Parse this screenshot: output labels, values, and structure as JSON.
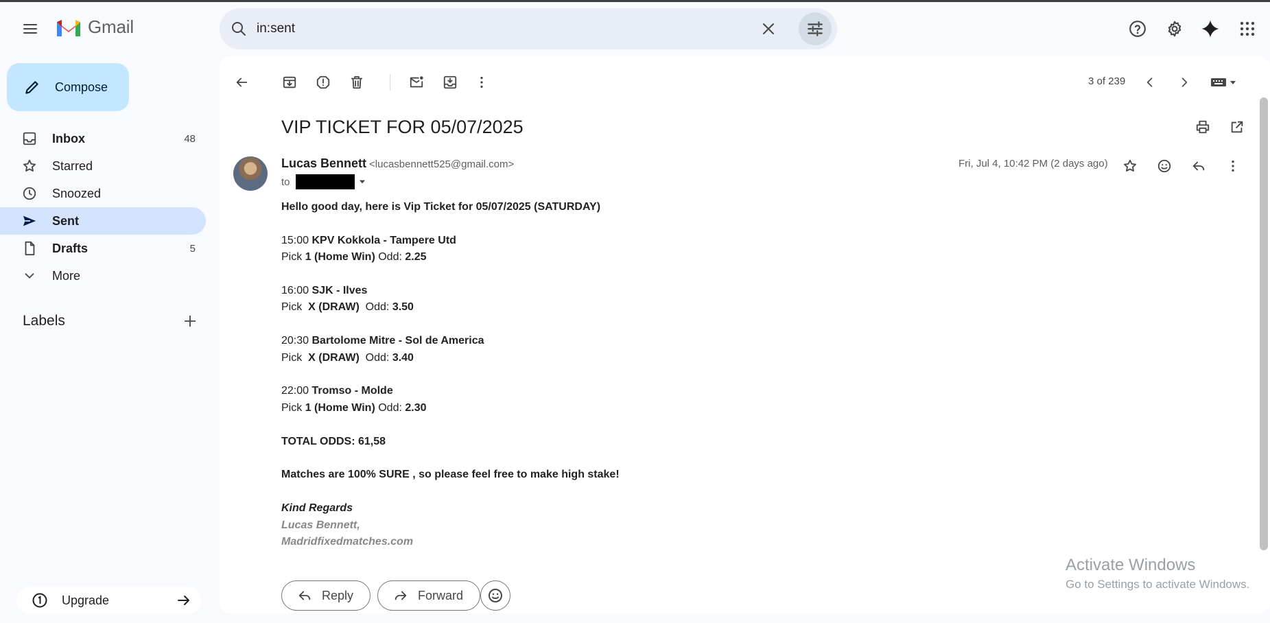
{
  "app": {
    "name": "Gmail"
  },
  "search": {
    "query": "in:sent"
  },
  "sidebar": {
    "compose_label": "Compose",
    "items": [
      {
        "label": "Inbox",
        "count": "48",
        "icon": "inbox-icon"
      },
      {
        "label": "Starred",
        "count": "",
        "icon": "star-icon"
      },
      {
        "label": "Snoozed",
        "count": "",
        "icon": "clock-icon"
      },
      {
        "label": "Sent",
        "count": "",
        "icon": "send-icon"
      },
      {
        "label": "Drafts",
        "count": "5",
        "icon": "draft-icon"
      },
      {
        "label": "More",
        "count": "",
        "icon": "chevron-down-icon"
      }
    ],
    "labels_title": "Labels",
    "upgrade_label": "Upgrade"
  },
  "toolbar": {
    "pager": "3 of 239"
  },
  "email": {
    "subject": "VIP TICKET FOR 05/07/2025",
    "sender_name": "Lucas Bennett",
    "sender_email": "<lucasbennett525@gmail.com>",
    "to_label": "to",
    "date": "Fri, Jul 4, 10:42 PM (2 days ago)",
    "greeting": "Hello good day, here is Vip Ticket for 05/07/2025 (SATURDAY)",
    "matches": [
      {
        "time": "15:00",
        "teams": "KPV Kokkola - Tampere Utd",
        "pick_label": "Pick",
        "pick": "1 (Home Win)",
        "odd_label": "Odd:",
        "odd": "2.25"
      },
      {
        "time": "16:00",
        "teams": "SJK - Ilves",
        "pick_label": "Pick",
        "pick": "X (DRAW)",
        "odd_label": "Odd:",
        "odd": "3.50"
      },
      {
        "time": "20:30",
        "teams": "Bartolome Mitre - Sol de America",
        "pick_label": "Pick",
        "pick": "X (DRAW)",
        "odd_label": "Odd:",
        "odd": "3.40"
      },
      {
        "time": "22:00",
        "teams": "Tromso - Molde",
        "pick_label": "Pick",
        "pick": "1 (Home Win)",
        "odd_label": "Odd:",
        "odd": "2.30"
      }
    ],
    "total": "TOTAL ODDS: 61,58",
    "note": "Matches are 100% SURE , so please feel free to make high stake!",
    "signoff": "Kind Regards",
    "sig_name": "Lucas Bennett,",
    "sig_site": "Madridfixedmatches.com"
  },
  "actions": {
    "reply": "Reply",
    "forward": "Forward"
  },
  "watermark": {
    "line1": "Activate Windows",
    "line2": "Go to Settings to activate Windows."
  },
  "colors": {
    "accent": "#c2e7ff",
    "active_nav": "#d3e3fd",
    "background": "#f8fafd"
  }
}
